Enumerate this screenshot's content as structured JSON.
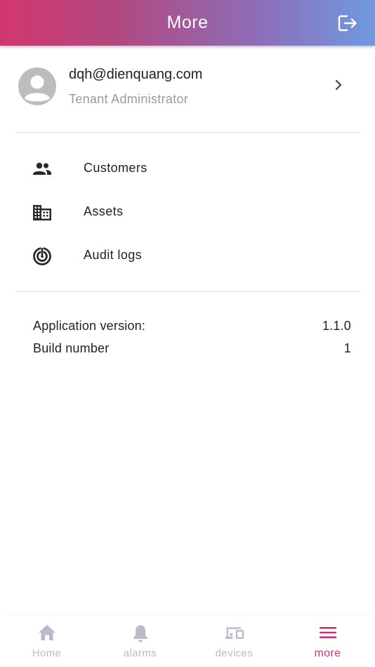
{
  "appbar": {
    "title": "More",
    "logout_icon": "logout-icon"
  },
  "profile": {
    "email": "dqh@dienquang.com",
    "role": "Tenant Administrator",
    "avatar_icon": "avatar-icon"
  },
  "menu": [
    {
      "label": "Customers",
      "icon": "customers-icon"
    },
    {
      "label": "Assets",
      "icon": "domain-icon"
    },
    {
      "label": "Audit logs",
      "icon": "track-changes-icon"
    }
  ],
  "info": {
    "version_label": "Application version:",
    "version_value": "1.1.0",
    "build_label": "Build number",
    "build_value": "1"
  },
  "bottom_nav": [
    {
      "label": "Home",
      "icon": "home-icon",
      "active": false
    },
    {
      "label": "alarms",
      "icon": "bell-icon",
      "active": false
    },
    {
      "label": "devices",
      "icon": "devices-icon",
      "active": false
    },
    {
      "label": "more",
      "icon": "menu-icon",
      "active": true
    }
  ],
  "colors": {
    "gradient_start": "#d3366e",
    "gradient_end": "#6f9ae0",
    "nav_active": "#c53677",
    "nav_inactive": "#b7bcc7"
  }
}
